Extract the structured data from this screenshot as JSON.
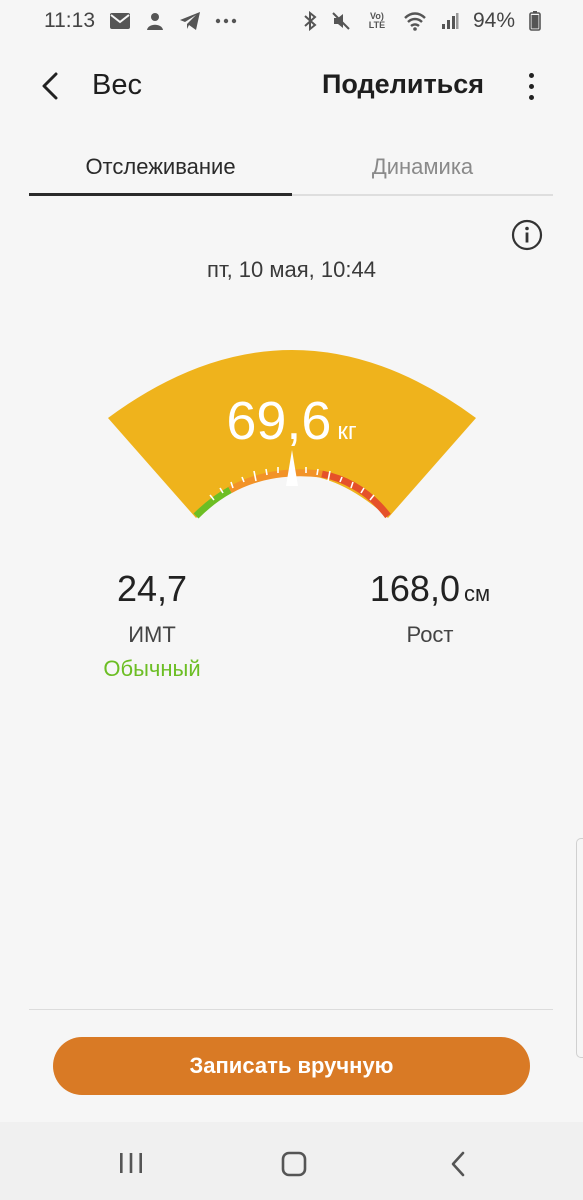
{
  "status_bar": {
    "time": "11:13",
    "battery": "94%",
    "network": "Vo) LTE",
    "left_icons": [
      "mail-icon",
      "user-badge-icon",
      "telegram-icon",
      "more-notifications-icon"
    ],
    "right_icons": [
      "bluetooth-icon",
      "mute-icon",
      "volte-icon",
      "wifi-icon",
      "signal-icon",
      "battery-icon"
    ]
  },
  "app_bar": {
    "title": "Вес",
    "share_label": "Поделиться",
    "back_icon": "chevron-left-icon",
    "more_icon": "more-vertical-icon"
  },
  "tabs": [
    {
      "label": "Отслеживание",
      "active": true
    },
    {
      "label": "Динамика",
      "active": false
    }
  ],
  "record": {
    "datetime": "пт, 10 мая, 10:44",
    "weight": {
      "value": "69,6",
      "unit": "кг"
    },
    "bmi": {
      "value": "24,7",
      "label": "ИМТ",
      "status": "Обычный",
      "status_color": "#6cbe24"
    },
    "height": {
      "value": "168,0",
      "unit": "см",
      "label": "Рост"
    }
  },
  "gauge": {
    "fill_color": "#efb31c",
    "zones": [
      "#6cbe24",
      "#f29328",
      "#e5512a"
    ],
    "needle_position": 0.5
  },
  "actions": {
    "record_manually": "Записать вручную",
    "button_color": "#d97a25"
  },
  "nav": {
    "recent_icon": "recent-apps-icon",
    "home_icon": "home-icon",
    "back_icon": "back-icon"
  }
}
